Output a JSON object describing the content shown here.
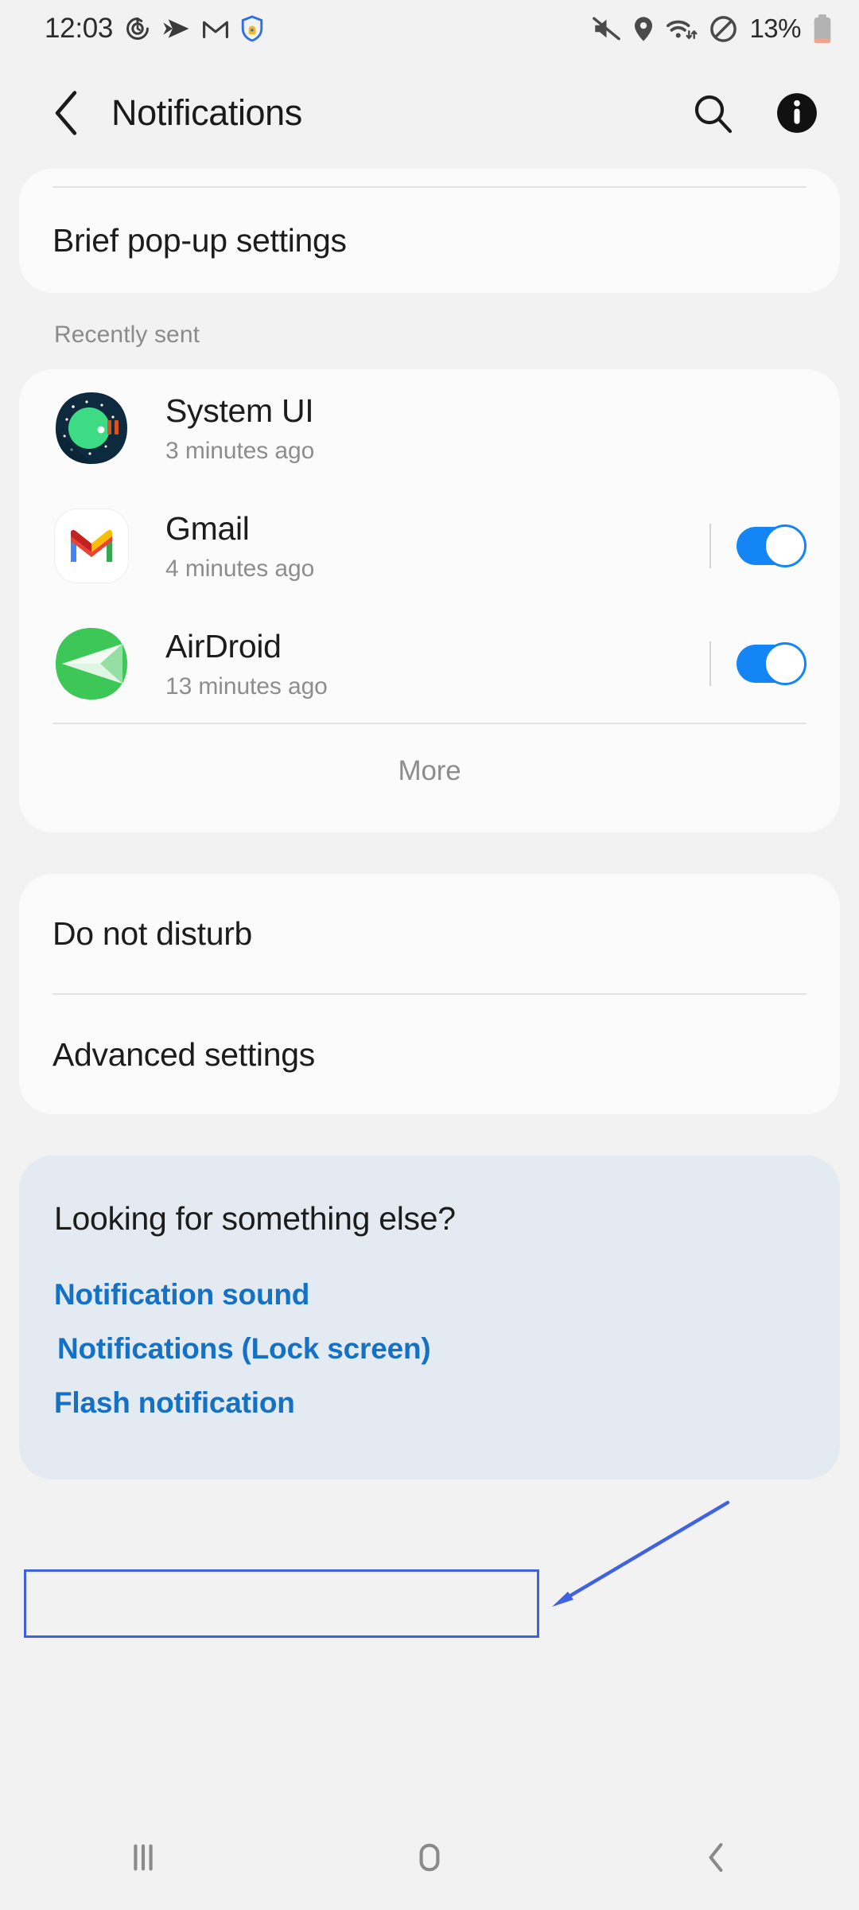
{
  "status_bar": {
    "clock": "12:03",
    "battery_percent": "13%",
    "left_icons": [
      "clock-rotate-icon",
      "gmail-m-icon",
      "shield-lock-icon"
    ],
    "right_icons": [
      "mute-icon",
      "location-icon",
      "wifi-icon",
      "do-not-disturb-icon"
    ]
  },
  "header": {
    "title": "Notifications",
    "back_icon": "chevron-left-icon",
    "search_icon": "search-icon",
    "info_icon": "info-icon"
  },
  "top_card": {
    "item_label": "Brief pop-up settings"
  },
  "recently_sent": {
    "section_label": "Recently sent",
    "apps": [
      {
        "name": "System UI",
        "time": "3 minutes ago",
        "icon": "android-11-icon",
        "has_toggle": false,
        "toggle_on": false
      },
      {
        "name": "Gmail",
        "time": "4 minutes ago",
        "icon": "gmail-icon",
        "has_toggle": true,
        "toggle_on": true
      },
      {
        "name": "AirDroid",
        "time": "13 minutes ago",
        "icon": "airdroid-icon",
        "has_toggle": true,
        "toggle_on": true
      }
    ],
    "more_label": "More"
  },
  "settings_card": {
    "items": [
      {
        "label": "Do not disturb"
      },
      {
        "label": "Advanced settings"
      }
    ]
  },
  "suggestions": {
    "title": "Looking for something else?",
    "links": [
      {
        "label": "Notification sound",
        "highlighted": false
      },
      {
        "label": "Notifications (Lock screen)",
        "highlighted": true
      },
      {
        "label": "Flash notification",
        "highlighted": false
      }
    ]
  },
  "nav_bar": {
    "recents_icon": "recents-icon",
    "home_icon": "home-icon",
    "back_icon": "back-icon"
  },
  "colors": {
    "background": "#f2f2f2",
    "card": "#fbfbfb",
    "suggest_card": "#e3eaf2",
    "link": "#1471c4",
    "toggle_on": "#1485f5",
    "annotation": "#3f63e0",
    "battery_low": "#f0a58a"
  }
}
